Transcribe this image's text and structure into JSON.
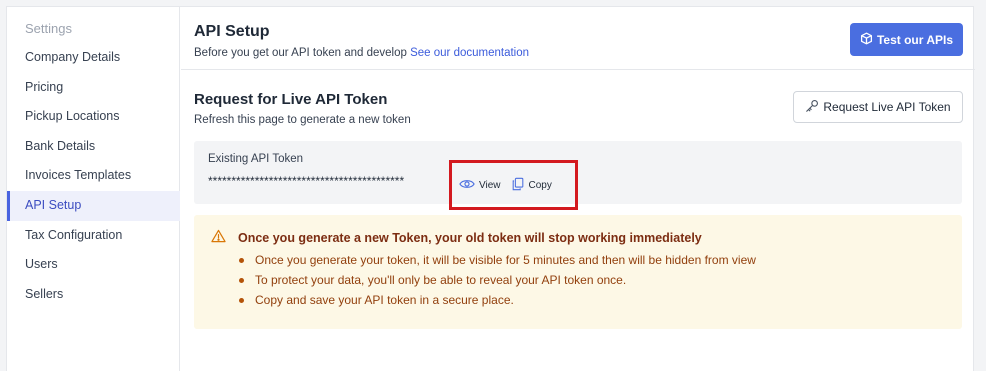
{
  "sidebar": {
    "heading": "Settings",
    "items": [
      {
        "label": "Company Details"
      },
      {
        "label": "Pricing"
      },
      {
        "label": "Pickup Locations"
      },
      {
        "label": "Bank Details"
      },
      {
        "label": "Invoices Templates"
      },
      {
        "label": "API Setup",
        "active": true
      },
      {
        "label": "Tax Configuration"
      },
      {
        "label": "Users"
      },
      {
        "label": "Sellers"
      }
    ]
  },
  "header": {
    "title": "API Setup",
    "subtitle_prefix": "Before you get our API token and develop",
    "subtitle_link": "See our documentation",
    "test_button_label": "Test our APIs",
    "test_button_icon": "cube-icon"
  },
  "request_section": {
    "title": "Request for Live API Token",
    "subtitle": "Refresh this page to generate a new token",
    "request_button_label": "Request Live API Token",
    "request_button_icon": "key-icon"
  },
  "token": {
    "label": "Existing API Token",
    "masked_value": "******************************************",
    "view_label": "View",
    "copy_label": "Copy"
  },
  "warning": {
    "title": "Once you generate a new Token, your old token will stop working immediately",
    "items": [
      "Once you generate your token, it will be visible for 5 minutes and then will be hidden from view",
      "To protect your data, you'll only be able to reveal your API token once.",
      "Copy and save your API token in a secure place."
    ]
  },
  "colors": {
    "accent": "#4a6ee0",
    "link": "#3b5bdb",
    "highlight_border": "#d3191f",
    "warning_bg": "#fdf8e6",
    "warning_text": "#92400e"
  }
}
